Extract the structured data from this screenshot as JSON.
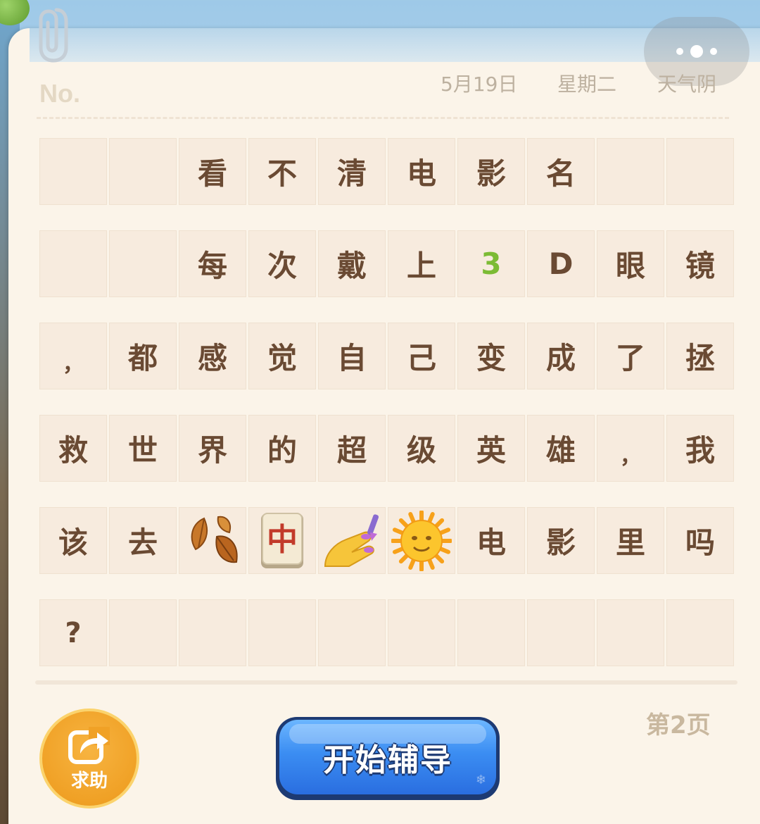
{
  "header": {
    "no_label": "No.",
    "date": "5月19日",
    "weekday": "星期二",
    "weather": "天气阴"
  },
  "grid": {
    "rows": [
      [
        {
          "type": "empty"
        },
        {
          "type": "empty"
        },
        {
          "type": "char",
          "text": "看"
        },
        {
          "type": "char",
          "text": "不"
        },
        {
          "type": "char",
          "text": "清"
        },
        {
          "type": "char",
          "text": "电"
        },
        {
          "type": "char",
          "text": "影"
        },
        {
          "type": "char",
          "text": "名"
        },
        {
          "type": "empty"
        },
        {
          "type": "empty"
        }
      ],
      [
        {
          "type": "empty"
        },
        {
          "type": "empty"
        },
        {
          "type": "char",
          "text": "每"
        },
        {
          "type": "char",
          "text": "次"
        },
        {
          "type": "char",
          "text": "戴"
        },
        {
          "type": "char",
          "text": "上"
        },
        {
          "type": "char",
          "text": "3",
          "color": "#7cbb34"
        },
        {
          "type": "char",
          "text": "D"
        },
        {
          "type": "char",
          "text": "眼"
        },
        {
          "type": "char",
          "text": "镜"
        }
      ],
      [
        {
          "type": "punct",
          "text": "，"
        },
        {
          "type": "char",
          "text": "都"
        },
        {
          "type": "char",
          "text": "感"
        },
        {
          "type": "char",
          "text": "觉"
        },
        {
          "type": "char",
          "text": "自"
        },
        {
          "type": "char",
          "text": "己"
        },
        {
          "type": "char",
          "text": "变"
        },
        {
          "type": "char",
          "text": "成"
        },
        {
          "type": "char",
          "text": "了"
        },
        {
          "type": "char",
          "text": "拯"
        }
      ],
      [
        {
          "type": "char",
          "text": "救"
        },
        {
          "type": "char",
          "text": "世"
        },
        {
          "type": "char",
          "text": "界"
        },
        {
          "type": "char",
          "text": "的"
        },
        {
          "type": "char",
          "text": "超"
        },
        {
          "type": "char",
          "text": "级"
        },
        {
          "type": "char",
          "text": "英"
        },
        {
          "type": "char",
          "text": "雄"
        },
        {
          "type": "punct",
          "text": "，"
        },
        {
          "type": "char",
          "text": "我"
        }
      ],
      [
        {
          "type": "char",
          "text": "该"
        },
        {
          "type": "char",
          "text": "去"
        },
        {
          "type": "emoji",
          "icon": "fallen-leaves-icon"
        },
        {
          "type": "emoji",
          "icon": "mahjong-red-dragon-icon",
          "text": "中"
        },
        {
          "type": "emoji",
          "icon": "nail-polish-icon"
        },
        {
          "type": "emoji",
          "icon": "sun-with-face-icon"
        },
        {
          "type": "char",
          "text": "电"
        },
        {
          "type": "char",
          "text": "影"
        },
        {
          "type": "char",
          "text": "里"
        },
        {
          "type": "char",
          "text": "吗"
        }
      ],
      [
        {
          "type": "char",
          "text": "?",
          "q": true
        },
        {
          "type": "empty"
        },
        {
          "type": "empty"
        },
        {
          "type": "empty"
        },
        {
          "type": "empty"
        },
        {
          "type": "empty"
        },
        {
          "type": "empty"
        },
        {
          "type": "empty"
        },
        {
          "type": "empty"
        },
        {
          "type": "empty"
        }
      ]
    ]
  },
  "footer": {
    "page_label": "第2页",
    "help_label": "求助",
    "start_label": "开始辅导"
  },
  "colors": {
    "paper": "#fbf4e9",
    "cell": "#f7ebde",
    "text": "#6a4a33",
    "accent_green": "#7cbb34",
    "help_orange": "#f0a126",
    "start_blue": "#3b8df2"
  }
}
